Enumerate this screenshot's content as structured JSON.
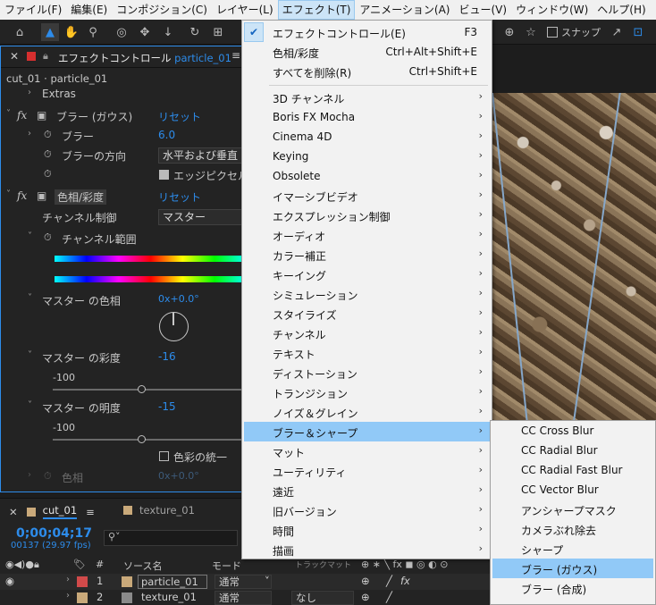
{
  "menubar": {
    "items": [
      {
        "label": "ファイル(F)"
      },
      {
        "label": "編集(E)"
      },
      {
        "label": "コンポジション(C)"
      },
      {
        "label": "レイヤー(L)"
      },
      {
        "label": "エフェクト(T)",
        "active": true
      },
      {
        "label": "アニメーション(A)"
      },
      {
        "label": "ビュー(V)"
      },
      {
        "label": "ウィンドウ(W)"
      },
      {
        "label": "ヘルプ(H)"
      }
    ]
  },
  "toolbar": {
    "snap_label": "スナップ",
    "tools": [
      "home-icon",
      "selection-arrow-icon",
      "hand-icon",
      "zoom-icon",
      "camera-orbit-icon",
      "pan-icon",
      "dolly-icon",
      "rotate-icon",
      "anchor-icon",
      "snap-icon",
      "expand-icon",
      "grid-icon"
    ]
  },
  "effect_panel": {
    "title": "エフェクトコントロール",
    "layer": "particle_01",
    "breadcrumb": "cut_01 · particle_01",
    "extras": "Extras",
    "gaussian": {
      "name": "ブラー (ガウス)",
      "reset": "リセット",
      "blur_label": "ブラー",
      "blur_value": "6.0",
      "dimension_label": "ブラーの方向",
      "dimension_value": "水平および垂直",
      "repeat_edge_label": "エッジピクセル"
    },
    "huesat": {
      "name": "色相/彩度",
      "reset": "リセット",
      "channel_control_label": "チャンネル制御",
      "channel_control_value": "マスター",
      "channel_range_label": "チャンネル範囲",
      "master_hue_label": "マスター の色相",
      "master_hue_value": "0x+0.0°",
      "master_sat_label": "マスター の彩度",
      "master_sat_value": "-16",
      "sat_min": "-100",
      "master_light_label": "マスター の明度",
      "master_light_value": "-15",
      "light_min": "-100",
      "colorize_label": "色彩の統一",
      "hue_label": "色相",
      "hue_value": "0x+0.0°"
    }
  },
  "effect_menu": {
    "items": [
      {
        "label": "エフェクトコントロール(E)",
        "shortcut": "F3",
        "checked": true
      },
      {
        "label": "色相/彩度",
        "shortcut": "Ctrl+Alt+Shift+E"
      },
      {
        "label": "すべてを削除(R)",
        "shortcut": "Ctrl+Shift+E"
      }
    ],
    "categories": [
      "3D チャンネル",
      "Boris FX Mocha",
      "Cinema 4D",
      "Keying",
      "Obsolete",
      "イマーシブビデオ",
      "エクスプレッション制御",
      "オーディオ",
      "カラー補正",
      "キーイング",
      "シミュレーション",
      "スタイライズ",
      "チャンネル",
      "テキスト",
      "ディストーション",
      "トランジション",
      "ノイズ＆グレイン",
      "ブラー＆シャープ",
      "マット",
      "ユーティリティ",
      "遠近",
      "旧バージョン",
      "時間",
      "描画"
    ],
    "highlighted": "ブラー＆シャープ"
  },
  "blur_submenu": {
    "items": [
      "CC Cross Blur",
      "CC Radial Blur",
      "CC Radial Fast Blur",
      "CC Vector Blur",
      "アンシャープマスク",
      "カメラぶれ除去",
      "シャープ",
      "ブラー (ガウス)",
      "ブラー (合成)"
    ],
    "highlighted": "ブラー (ガウス)"
  },
  "timeline": {
    "tabs": [
      {
        "label": "cut_01",
        "color": "#c9a97a",
        "active": true
      },
      {
        "label": "texture_01",
        "color": "#c9a97a"
      }
    ],
    "timecode": "0;00;04;17",
    "frames": "00137 (29.97 fps)",
    "search_placeholder": "",
    "columns": {
      "num": "#",
      "source": "ソース名",
      "mode": "モード",
      "trkmat": "トラックマット"
    },
    "layers": [
      {
        "num": "1",
        "name": "particle_01",
        "mode": "通常",
        "color": "#d14a4a",
        "selected": true
      },
      {
        "num": "2",
        "name": "texture_01",
        "mode": "通常",
        "trkmat": "なし",
        "color": "#c9a97a"
      }
    ]
  },
  "colors": {
    "accent": "#2d8ceb",
    "menu_bg": "#f2f2f2",
    "menu_highlight": "#91c9f7"
  }
}
